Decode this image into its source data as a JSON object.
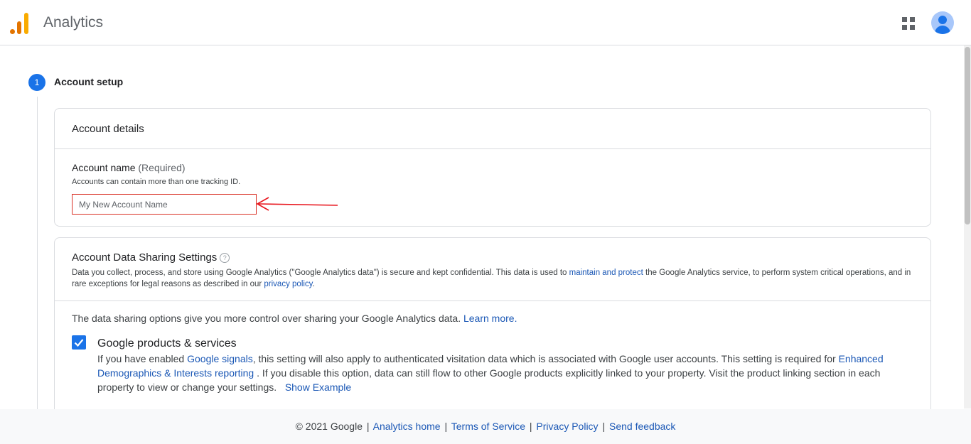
{
  "header": {
    "app_title": "Analytics",
    "apps_icon": "apps-grid-icon",
    "avatar_icon": "account-avatar-icon"
  },
  "step": {
    "number": "1",
    "label": "Account setup"
  },
  "account_details": {
    "title": "Account details",
    "field_label": "Account name",
    "field_required": "(Required)",
    "field_hint": "Accounts can contain more than one tracking ID.",
    "input_placeholder": "My New Account Name",
    "input_value": ""
  },
  "data_sharing": {
    "title": "Account Data Sharing Settings",
    "help_glyph": "?",
    "desc_part1": "Data you collect, process, and store using Google Analytics (\"Google Analytics data\") is secure and kept confidential. This data is used to ",
    "desc_link1": "maintain and protect",
    "desc_part2": " the Google Analytics service, to perform system critical operations, and in rare exceptions for legal reasons as described in our ",
    "desc_link2": "privacy policy",
    "desc_part3": ".",
    "intro_text": "The data sharing options give you more control over sharing your Google Analytics data. ",
    "intro_link": "Learn more.",
    "option": {
      "title": "Google products & services",
      "checked": true,
      "desc_part1": "If you have enabled ",
      "desc_link1": "Google signals",
      "desc_part2": ", this setting will also apply to authenticated visitation data which is associated with Google user accounts. This setting is required for ",
      "desc_link2": "Enhanced Demographics & Interests reporting",
      "desc_part3": " . If you disable this option, data can still flow to other Google products explicitly linked to your property. Visit the product linking section in each property to view or change your settings.",
      "desc_link3": "Show Example"
    }
  },
  "footer": {
    "copyright": "© 2021 Google",
    "sep": "|",
    "links": [
      "Analytics home",
      "Terms of Service",
      "Privacy Policy",
      "Send feedback"
    ]
  },
  "colors": {
    "accent": "#1a73e8",
    "error_border": "#d93025",
    "annotation_arrow": "#e8141c"
  }
}
